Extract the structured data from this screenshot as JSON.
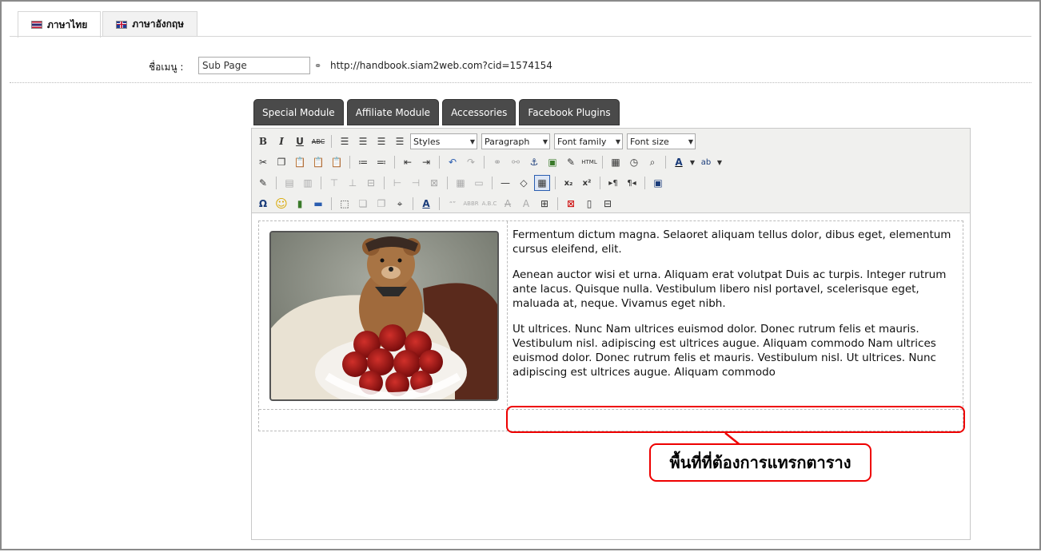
{
  "tabs": [
    {
      "label": "ภาษาไทย",
      "flag": "thai-flag-icon",
      "active": true
    },
    {
      "label": "ภาษาอังกฤษ",
      "flag": "uk-flag-icon",
      "active": false
    }
  ],
  "menu": {
    "label": "ชื่อเมนู :",
    "value": "Sub Page",
    "url": "http://handbook.siam2web.com?cid=1574154"
  },
  "module_buttons": [
    "Special Module",
    "Affiliate Module",
    "Accessories",
    "Facebook Plugins"
  ],
  "toolbar": {
    "styles": "Styles",
    "format": "Paragraph",
    "font_family": "Font family",
    "font_size": "Font size"
  },
  "content": {
    "paragraphs": [
      "Fermentum dictum magna. Selaoret aliquam tellus dolor, dibus eget, elementum cursus eleifend, elit.",
      "Aenean auctor wisi et urna. Aliquam erat volutpat Duis ac turpis. Integer rutrum ante lacus. Quisque nulla. Vestibulum libero nisl portavel, scelerisque eget, maluada at, neque. Vivamus eget nibh.",
      "Ut ultrices. Nunc Nam ultrices euismod dolor. Donec rutrum felis et mauris. Vestibulum nisl. adipiscing est ultrices augue. Aliquam commodo Nam ultrices euismod dolor. Donec rutrum felis et mauris. Vestibulum nisl. Ut ultrices. Nunc adipiscing est ultrices augue. Aliquam commodo"
    ]
  },
  "callout": {
    "text": "พื้นที่ที่ต้องการแทรกตาราง",
    "color": "#e00000"
  }
}
